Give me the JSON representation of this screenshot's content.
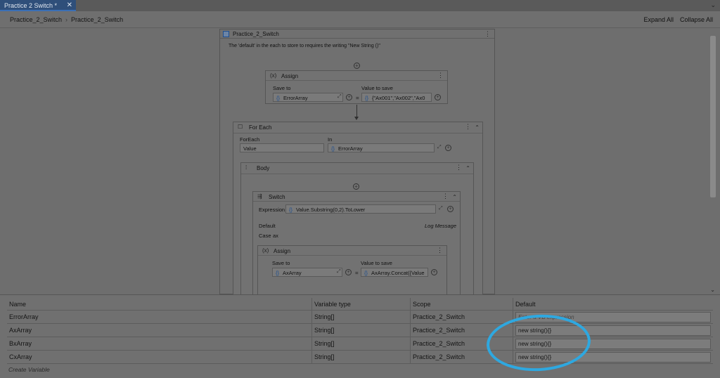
{
  "tab": {
    "title": "Practice 2 Switch *",
    "close": "✕"
  },
  "breadcrumb": {
    "items": [
      "Practice_2_Switch",
      "Practice_2_Switch"
    ],
    "separator": "›"
  },
  "toolbar": {
    "expand_all": "Expand All",
    "collapse_all": "Collapse All"
  },
  "sequence": {
    "title": "Practice_2_Switch",
    "annotation": "The 'default' in the each to store to requires the writing \"New String ()\"",
    "assign1": {
      "title": "Assign",
      "save_to_label": "Save to",
      "value_label": "Value to save",
      "save_to": "ErrorArray",
      "value": "{\"Ax001\",\"Ax002\",\"Ax0"
    },
    "foreach": {
      "title": "For Each",
      "foreach_label": "ForEach",
      "in_label": "In",
      "item": "Value",
      "in": "ErrorArray"
    },
    "body": {
      "title": "Body"
    },
    "switch": {
      "title": "Switch",
      "expression_label": "Expression",
      "expression": "Value.Substring(0,2).ToLower",
      "default_label": "Default",
      "log_message": "Log Message",
      "case_label": "Case",
      "case_value": "ax"
    },
    "assign2": {
      "title": "Assign",
      "save_to_label": "Save to",
      "value_label": "Value to save",
      "save_to": "AxArray",
      "value": "AxArray.Concat({Value"
    }
  },
  "variables": {
    "headers": [
      "Name",
      "Variable type",
      "Scope",
      "Default"
    ],
    "rows": [
      {
        "name": "ErrorArray",
        "type": "String[]",
        "scope": "Practice_2_Switch",
        "default": "Enter a VB expression"
      },
      {
        "name": "AxArray",
        "type": "String[]",
        "scope": "Practice_2_Switch",
        "default": "new string(){}"
      },
      {
        "name": "BxArray",
        "type": "String[]",
        "scope": "Practice_2_Switch",
        "default": "new string(){}"
      },
      {
        "name": "CxArray",
        "type": "String[]",
        "scope": "Practice_2_Switch",
        "default": "new string(){}"
      }
    ],
    "create_variable": "Create Variable"
  },
  "colors": {
    "highlight_circle": "#2ea8e0",
    "tab_active": "#2f4f7a"
  }
}
